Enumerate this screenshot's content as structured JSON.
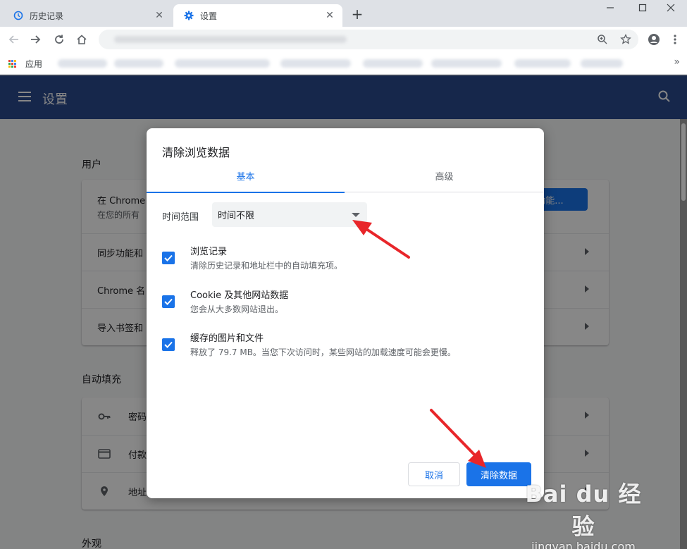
{
  "tabs": [
    {
      "label": "历史记录",
      "icon": "history-icon"
    },
    {
      "label": "设置",
      "icon": "settings-gear-icon"
    }
  ],
  "toolbar": {
    "address_blurred": true
  },
  "bookmarks": {
    "apps_label": "应用"
  },
  "settings": {
    "header_title": "设置",
    "section_user": "用户",
    "user_rows": [
      {
        "title": "在 Chrome",
        "sub": "在您的所有",
        "button": "步功能..."
      },
      {
        "title": "同步功能和"
      },
      {
        "title": "Chrome 名"
      },
      {
        "title": "导入书签和"
      }
    ],
    "section_autofill": "自动填充",
    "autofill_rows": [
      {
        "title": "密码",
        "icon": "key-icon"
      },
      {
        "title": "付款",
        "icon": "credit-card-icon"
      },
      {
        "title": "地址",
        "icon": "location-pin-icon"
      }
    ],
    "section_appearance": "外观"
  },
  "dialog": {
    "title": "清除浏览数据",
    "tabs": [
      "基本",
      "高级"
    ],
    "range_label": "时间范围",
    "range_value": "时间不限",
    "options": [
      {
        "title": "浏览记录",
        "desc": "清除历史记录和地址栏中的自动填充项。",
        "checked": true
      },
      {
        "title": "Cookie 及其他网站数据",
        "desc": "您会从大多数网站退出。",
        "checked": true
      },
      {
        "title": "缓存的图片和文件",
        "desc": "释放了 79.7 MB。当您下次访问时，某些网站的加载速度可能会更慢。",
        "checked": true
      }
    ],
    "cancel": "取消",
    "clear": "清除数据"
  },
  "watermark": {
    "logo": "Bai du 经验",
    "sub": "jingyan.baidu.com"
  },
  "colors": {
    "accent": "#1a73e8",
    "header": "#2a4a8f",
    "arrow": "#e8262a"
  }
}
